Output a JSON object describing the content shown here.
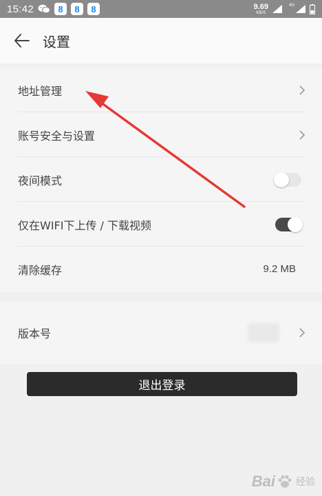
{
  "statusbar": {
    "time": "15:42",
    "badges": [
      "8",
      "8",
      "8"
    ],
    "speed_value": "9.69",
    "speed_unit": "KB/S",
    "network": "4G"
  },
  "header": {
    "title": "设置"
  },
  "settings": {
    "address": {
      "label": "地址管理"
    },
    "account": {
      "label": "账号安全与设置"
    },
    "night": {
      "label": "夜间模式",
      "enabled": false
    },
    "wifi": {
      "label": "仅在WIFI下上传 / 下载视频",
      "enabled": true
    },
    "cache": {
      "label": "清除缓存",
      "value": "9.2 MB"
    }
  },
  "version": {
    "label": "版本号"
  },
  "logout": {
    "label": "退出登录"
  },
  "watermark": {
    "text_a": "Bai",
    "text_b": "经验"
  },
  "colors": {
    "arrow": "#e53935",
    "toggle_on": "#4a4a4a",
    "toggle_off": "#e6e6e6",
    "logout_bg": "#2b2b2b"
  }
}
